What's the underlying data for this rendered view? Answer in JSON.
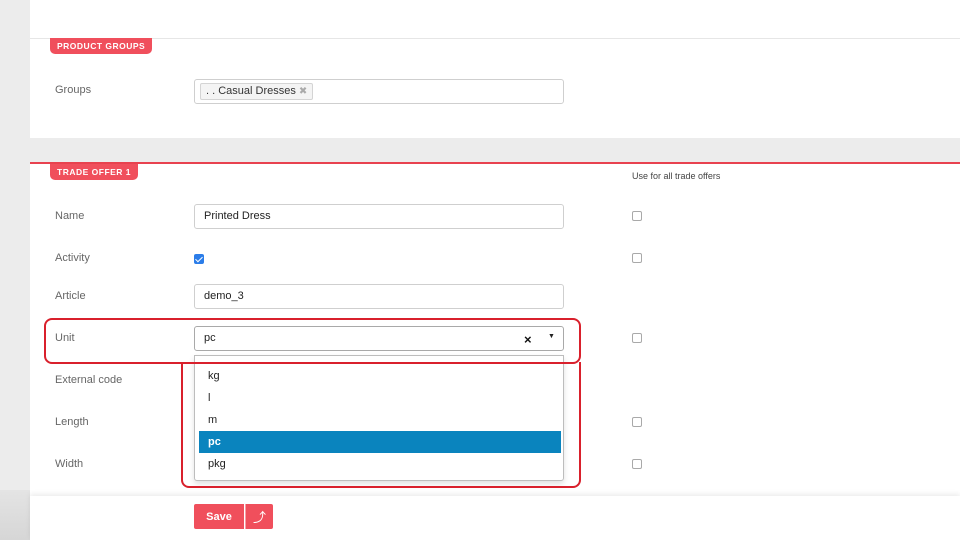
{
  "product_groups": {
    "tab_label": "PRODUCT GROUPS",
    "groups_label": "Groups",
    "selected_tag": ". . Casual Dresses",
    "tag_remove_glyph": "✖"
  },
  "trade_offer": {
    "tab_label": "TRADE OFFER 1",
    "use_for_all_header": "Use for all trade offers",
    "fields": {
      "name": {
        "label": "Name",
        "value": "Printed Dress"
      },
      "activity": {
        "label": "Activity"
      },
      "article": {
        "label": "Article",
        "value": "demo_3"
      },
      "unit": {
        "label": "Unit",
        "value": "pc",
        "clear_glyph": "×",
        "arrow_glyph": "▼"
      },
      "external_code": {
        "label": "External code"
      },
      "length": {
        "label": "Length"
      },
      "width": {
        "label": "Width"
      }
    },
    "unit_options": [
      "kg",
      "l",
      "m",
      "pc",
      "pkg"
    ],
    "unit_selected": "pc"
  },
  "footer": {
    "save_label": "Save",
    "up_glyph": "⤴"
  },
  "colors": {
    "accent": "#f04f5c",
    "highlight_border": "#d9202c",
    "option_selected": "#0a84be",
    "checkbox_checked": "#2b7de9"
  }
}
